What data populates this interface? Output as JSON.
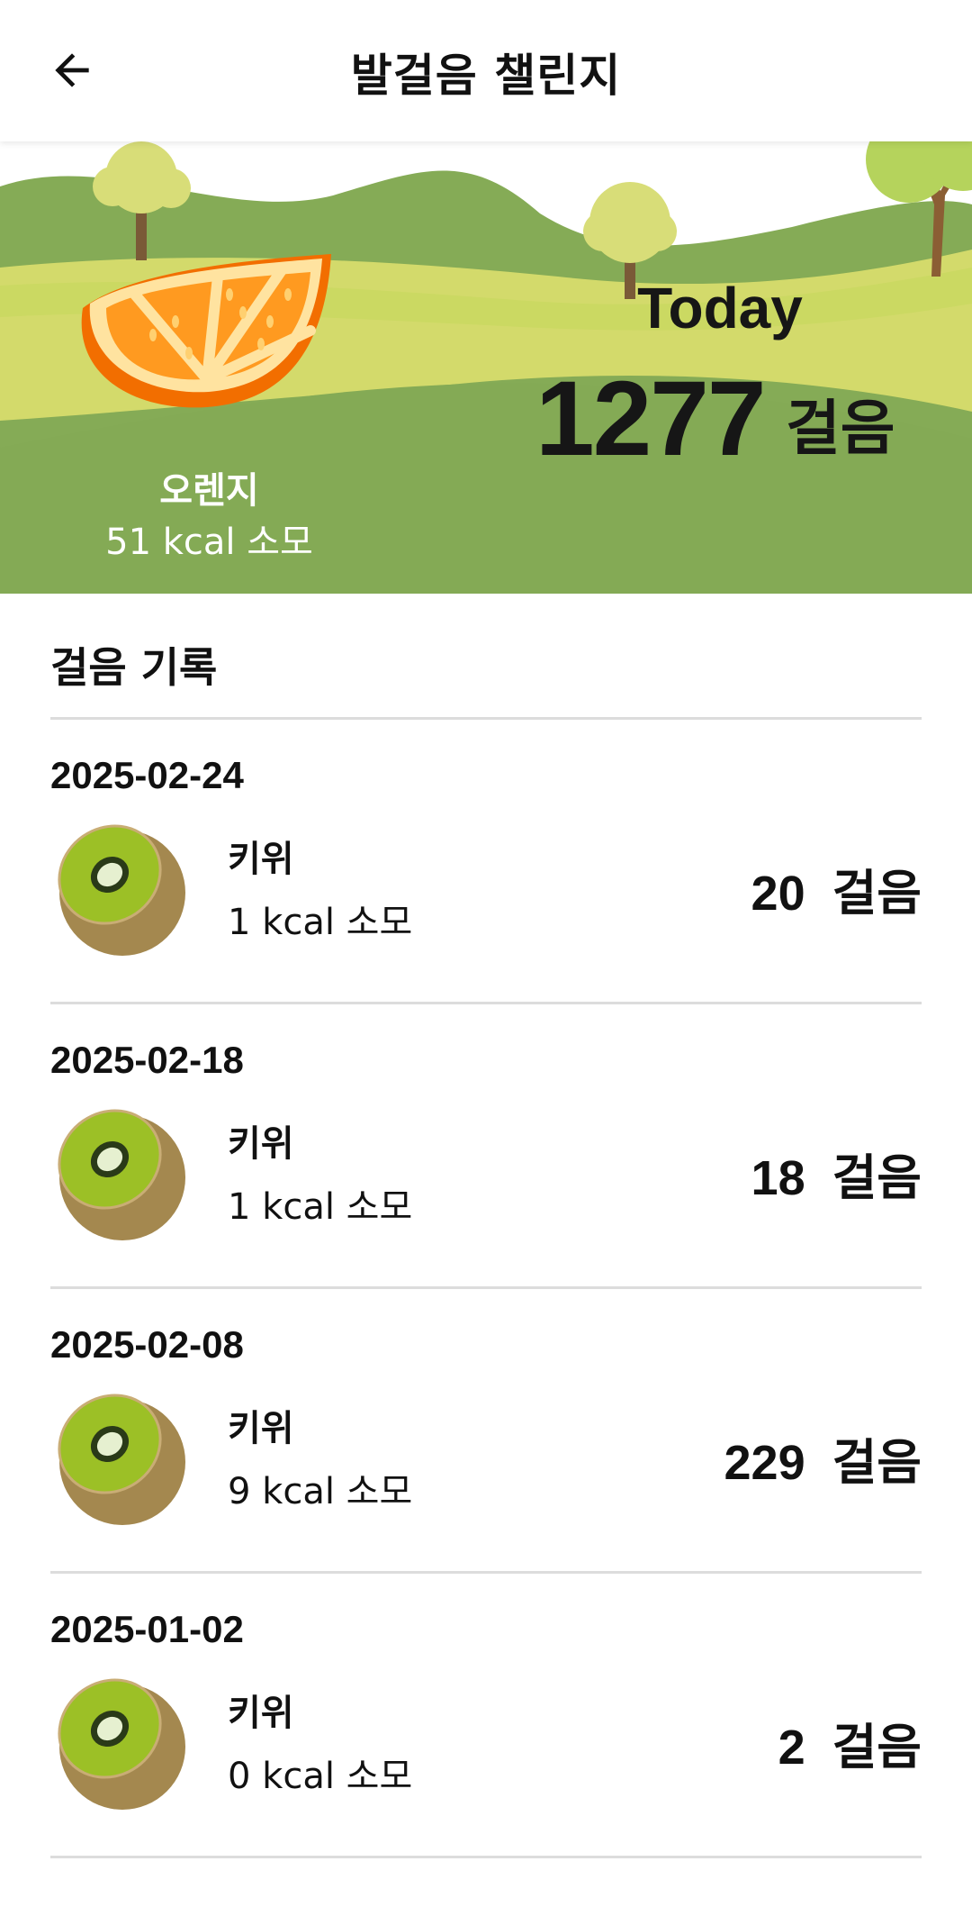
{
  "app_bar": {
    "title": "발걸음 챌린지",
    "back_icon": "arrow-left-icon"
  },
  "today": {
    "label": "Today",
    "steps": "1277",
    "unit": "걸음",
    "fruit_name": "오렌지",
    "fruit_kcal": "51 kcal 소모",
    "fruit_icon": "orange-slice-icon"
  },
  "history": {
    "title": "걸음 기록",
    "records": [
      {
        "date": "2025-02-24",
        "fruit": "키위",
        "kcal": "1 kcal 소모",
        "steps": "20",
        "unit": "걸음",
        "icon": "kiwi-icon"
      },
      {
        "date": "2025-02-18",
        "fruit": "키위",
        "kcal": "1 kcal 소모",
        "steps": "18",
        "unit": "걸음",
        "icon": "kiwi-icon"
      },
      {
        "date": "2025-02-08",
        "fruit": "키위",
        "kcal": "9 kcal 소모",
        "steps": "229",
        "unit": "걸음",
        "icon": "kiwi-icon"
      },
      {
        "date": "2025-01-02",
        "fruit": "키위",
        "kcal": "0 kcal 소모",
        "steps": "2",
        "unit": "걸음",
        "icon": "kiwi-icon"
      }
    ]
  },
  "colors": {
    "hill_dark": "#84ab55",
    "hill_light": "#d4db6a",
    "orange": "#ff8a1d",
    "kiwi_flesh": "#9cc026",
    "kiwi_skin": "#a4884f"
  }
}
